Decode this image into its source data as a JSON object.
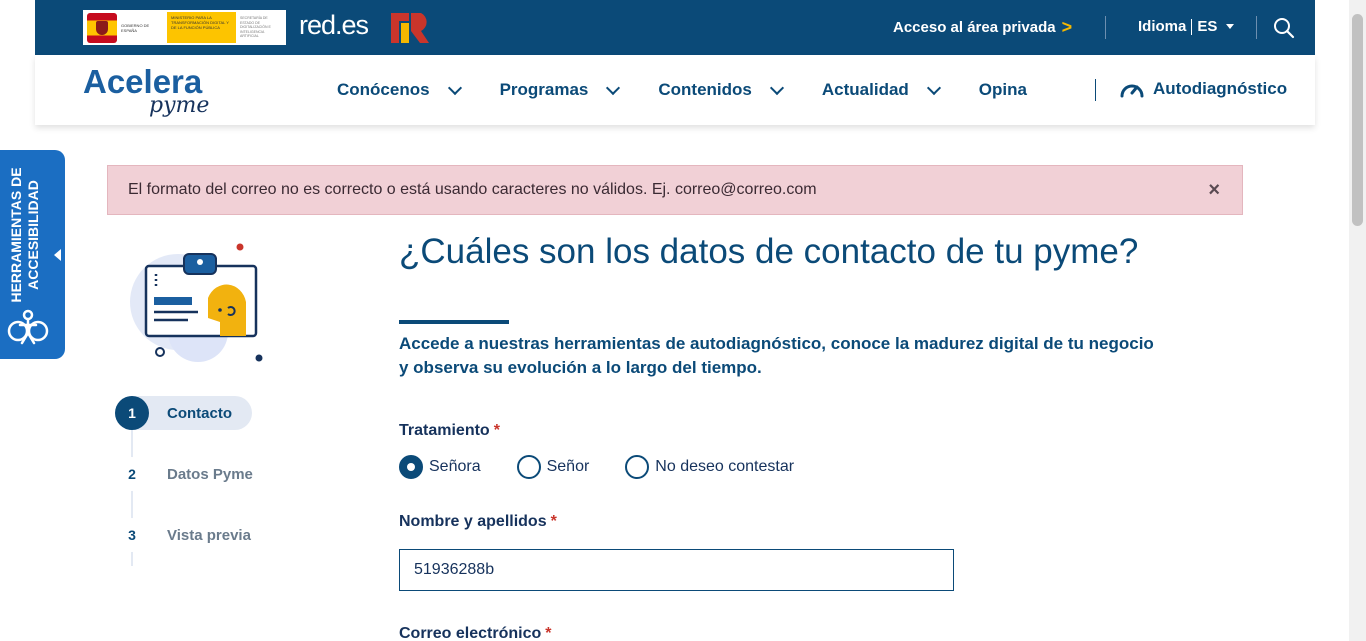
{
  "topbar": {
    "gov_logo": {
      "left_text": "GOBIERNO DE ESPAÑA",
      "ministry_text": "MINISTERIO PARA LA TRANSFORMACIÓN DIGITAL Y DE LA FUNCIÓN PÚBLICA",
      "right_text": "SECRETARÍA DE ESTADO DE DIGITALIZACIÓN E INTELIGENCIA ARTIFICIAL"
    },
    "redes_logo": "red.es",
    "private_area_label": "Acceso al área privada",
    "private_area_arrow": ">",
    "language_label": "Idioma",
    "language_code": "ES",
    "colors": {
      "background": "#0b4a78",
      "accent": "#f5b800"
    }
  },
  "nav": {
    "brand_main": "Acelera",
    "brand_sub": "pyme",
    "menu": [
      {
        "label": "Conócenos",
        "has_dropdown": true
      },
      {
        "label": "Programas",
        "has_dropdown": true
      },
      {
        "label": "Contenidos",
        "has_dropdown": true
      },
      {
        "label": "Actualidad",
        "has_dropdown": true
      },
      {
        "label": "Opina",
        "has_dropdown": false
      }
    ],
    "autodiag_label": "Autodiagnóstico"
  },
  "accessibility_tab": {
    "label": "HERRAMIENTAS DE ACCESIBILIDAD",
    "icon": "accessibility-icon",
    "color": "#1b6ec2"
  },
  "alert": {
    "message": "El formato del correo no es correcto o está usando caracteres no válidos. Ej. correo@correo.com",
    "close": "×"
  },
  "steps": [
    {
      "number": "1",
      "label": "Contacto",
      "active": true
    },
    {
      "number": "2",
      "label": "Datos Pyme",
      "active": false
    },
    {
      "number": "3",
      "label": "Vista previa",
      "active": false
    }
  ],
  "form": {
    "title": "¿Cuáles son los datos de contacto de tu pyme?",
    "subtitle": "Accede a nuestras herramientas de autodiagnóstico, conoce la madurez digital de tu negocio y observa su evolución a lo largo del tiempo.",
    "treatment_label": "Tratamiento",
    "required_mark": "*",
    "treatment_options": [
      {
        "label": "Señora",
        "checked": true
      },
      {
        "label": "Señor",
        "checked": false
      },
      {
        "label": "No deseo contestar",
        "checked": false
      }
    ],
    "name_label": "Nombre y apellidos",
    "name_value": "51936288b",
    "email_label": "Correo electrónico"
  }
}
